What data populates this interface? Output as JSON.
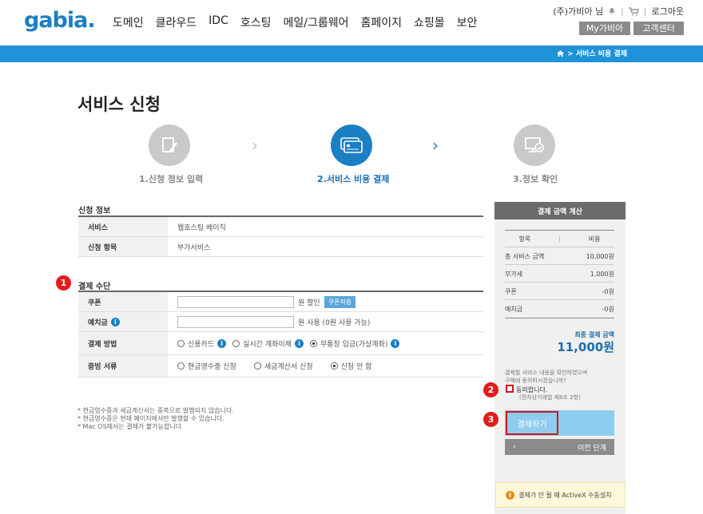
{
  "header": {
    "logo": "gabia.",
    "nav": [
      "도메인",
      "클라우드",
      "IDC",
      "호스팅",
      "메일/그룹웨어",
      "홈페이지",
      "쇼핑몰",
      "보안"
    ],
    "user": "(주)가비아 님",
    "logout": "로그아웃",
    "my_btn": "My가비아",
    "cs_btn": "고객센터"
  },
  "breadcrumb": "> 서비스 비용 결제",
  "page_title": "서비스 신청",
  "steps": [
    {
      "label": "1.신청 정보 입력"
    },
    {
      "label": "2.서비스 비용 결제"
    },
    {
      "label": "3.정보 확인"
    }
  ],
  "apply_info": {
    "title": "신청 정보",
    "rows": [
      {
        "th": "서비스",
        "td": "웹호스팅 베이직"
      },
      {
        "th": "신청 항목",
        "td": "부가서비스"
      }
    ]
  },
  "payment": {
    "badge": "1",
    "title": "결제 수단",
    "coupon_label": "쿠폰",
    "coupon_suffix": "원 할인",
    "coupon_btn": "쿠폰적용",
    "deposit_label": "예치금",
    "deposit_suffix": "원 사용 (0원 사용 가능)",
    "method_label": "결제 방법",
    "methods": [
      "신용카드",
      "실시간 계좌이체",
      "무통장 입금(가상계좌)"
    ],
    "receipt_label": "증빙 서류",
    "receipts": [
      "현금영수증 신청",
      "세금계산서 신청",
      "신청 안 함"
    ]
  },
  "notes": [
    "* 현금영수증과 세금계산서는 중복으로 발행되지 않습니다.",
    "* 현금영수증은 현재 페이지에서만 발행할 수 있습니다.",
    "* Mac OS에서는 결제가 불가능합니다"
  ],
  "calc": {
    "title": "결제 금액 계산",
    "col_item": "항목",
    "col_cost": "비용",
    "rows": [
      {
        "item": "총 서비스 금액",
        "cost": "10,000원"
      },
      {
        "item": "부가세",
        "cost": "1,000원"
      },
      {
        "item": "쿠폰",
        "cost": "-0원"
      },
      {
        "item": "예치금",
        "cost": "-0원"
      }
    ],
    "final_label": "최종 결제 금액",
    "final_amount": "11,000원",
    "agree_text1": "결제할 서비스 내용을 확인하였으며",
    "agree_text2": "구매에 동의하시겠습니까?",
    "agree_check": "동의합니다.",
    "agree_sub": "(전자상거래법 제8조 2항)",
    "badge2": "2",
    "badge3": "3",
    "pay_btn": "결제하기",
    "prev_btn": "이전 단계",
    "activex": "결제가 안 될 때 ActiveX 수동설치"
  }
}
